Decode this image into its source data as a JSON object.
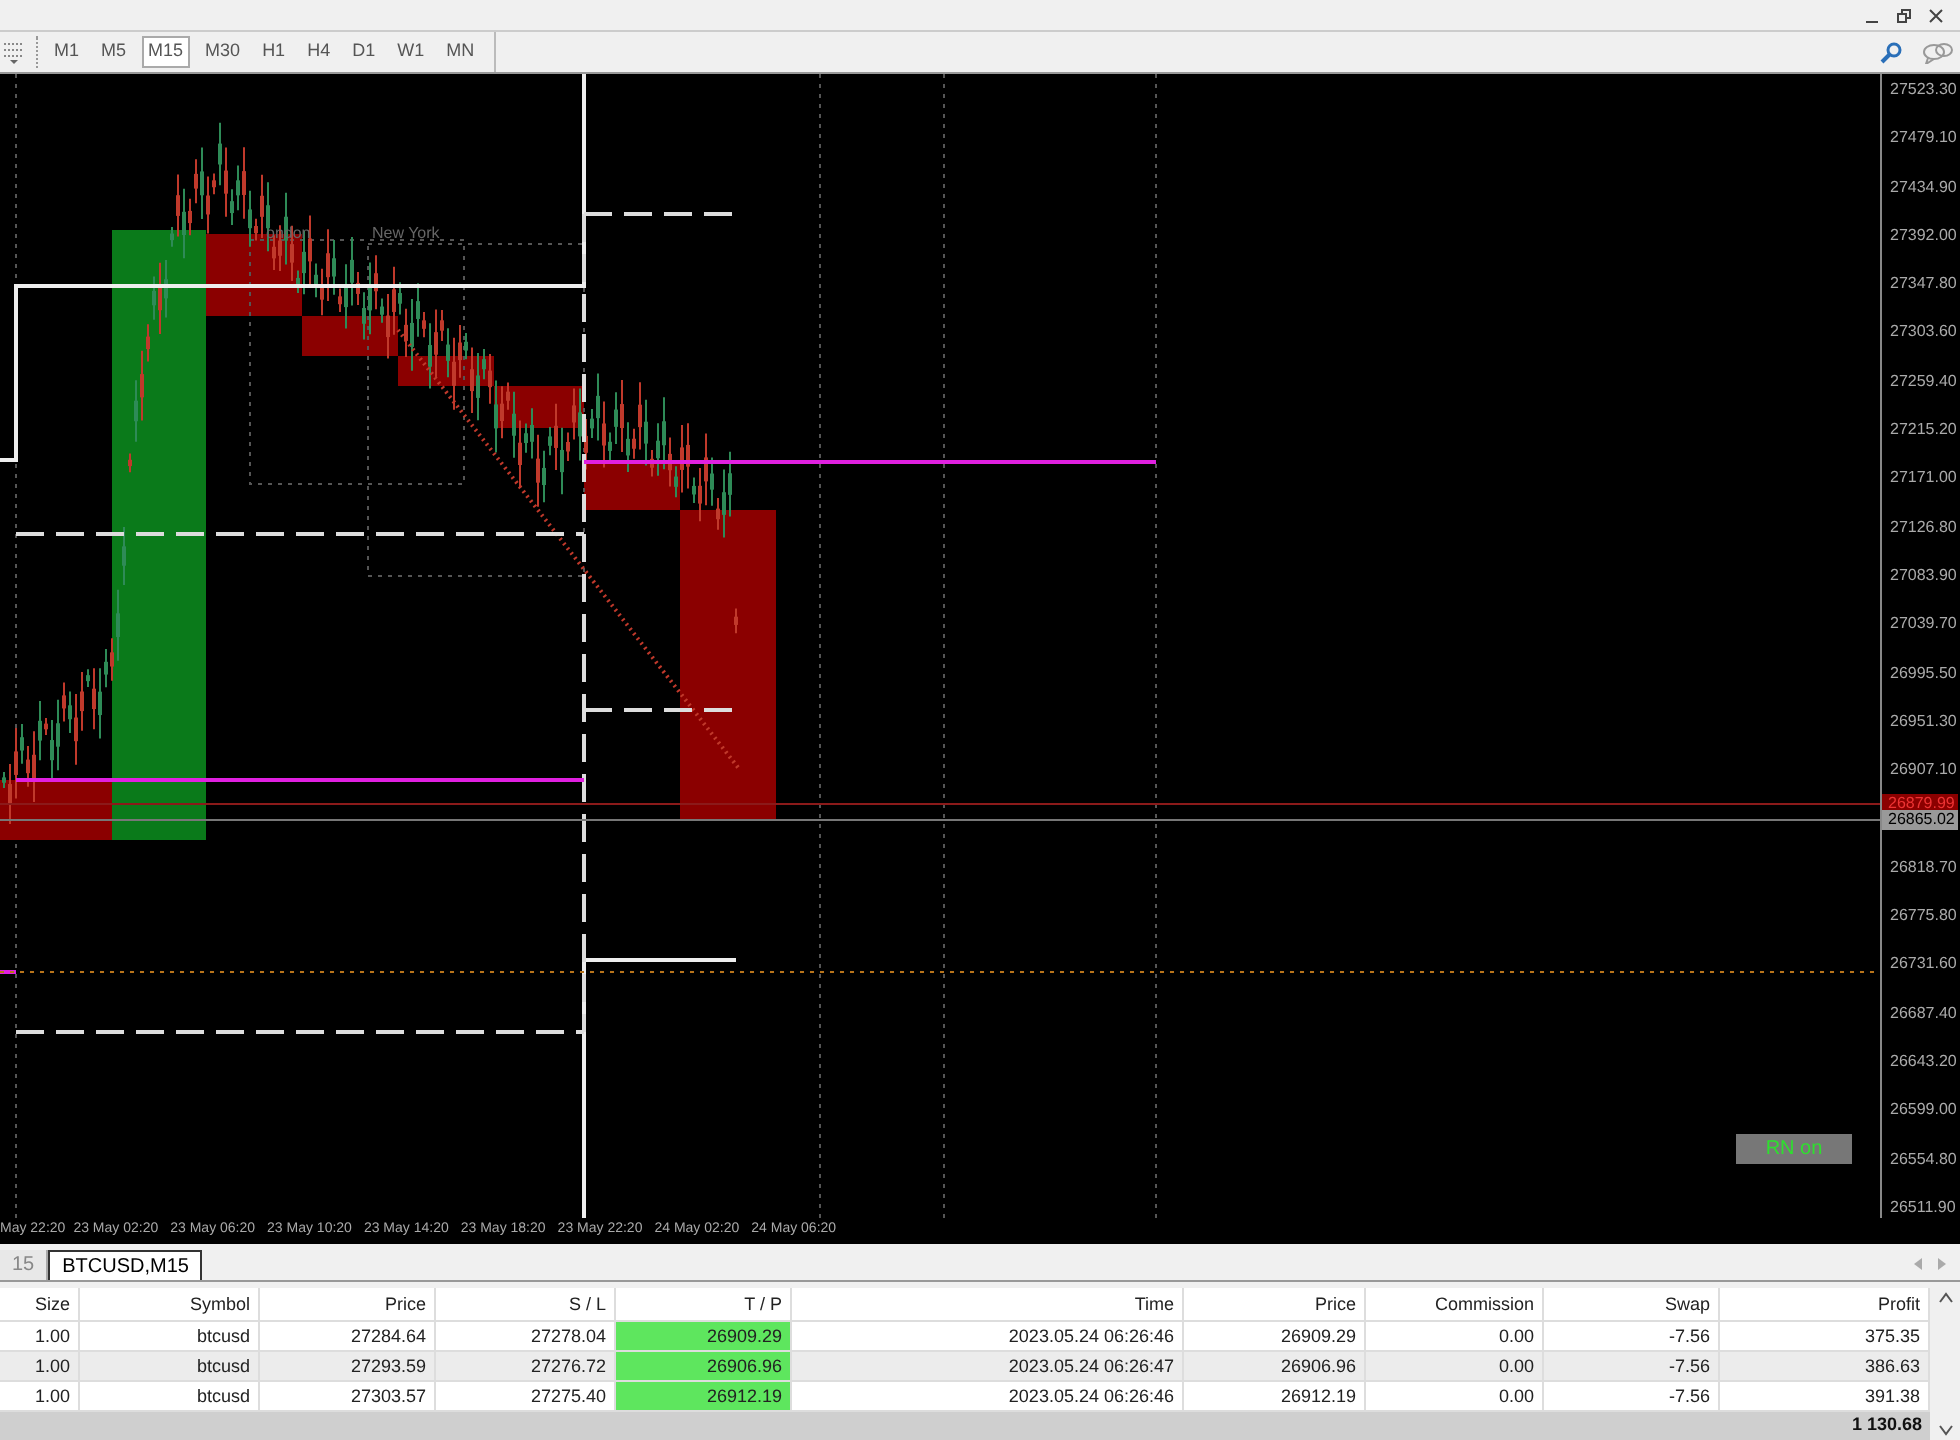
{
  "toolbar": {
    "timeframes": [
      {
        "label": "M1",
        "selected": false
      },
      {
        "label": "M5",
        "selected": false
      },
      {
        "label": "M15",
        "selected": true
      },
      {
        "label": "M30",
        "selected": false
      },
      {
        "label": "H1",
        "selected": false
      },
      {
        "label": "H4",
        "selected": false
      },
      {
        "label": "D1",
        "selected": false
      },
      {
        "label": "W1",
        "selected": false
      },
      {
        "label": "MN",
        "selected": false
      }
    ]
  },
  "chart": {
    "session_labels": [
      "ondon",
      "New York"
    ],
    "price_labels_upper": [
      "27523.30",
      "27479.10",
      "27434.90",
      "27392.00",
      "27347.80",
      "27303.60",
      "27259.40",
      "27215.20",
      "27171.00",
      "27126.80",
      "27083.90",
      "27039.70",
      "26995.50",
      "26951.30",
      "26907.10"
    ],
    "price_labels_lower": [
      "26818.70",
      "26775.80",
      "26731.60",
      "26687.40",
      "26643.20",
      "26599.00",
      "26554.80",
      "26511.90"
    ],
    "price_tags": [
      {
        "text": "26879.99",
        "kind": "bid"
      },
      {
        "text": "26865.02",
        "kind": "last"
      }
    ],
    "time_labels": [
      "May 22:20",
      "23 May 02:20",
      "23 May 06:20",
      "23 May 10:20",
      "23 May 14:20",
      "23 May 18:20",
      "23 May 22:20",
      "24 May 02:20",
      "24 May 06:20"
    ],
    "indicator_button": "RN on"
  },
  "tabs": [
    {
      "label": "15",
      "selected": false
    },
    {
      "label": "BTCUSD,M15",
      "selected": true
    }
  ],
  "table": {
    "columns": [
      "Size",
      "Symbol",
      "Price",
      "S / L",
      "T / P",
      "Time",
      "Price",
      "Commission",
      "Swap",
      "Profit"
    ],
    "rows": [
      [
        "1.00",
        "btcusd",
        "27284.64",
        "27278.04",
        "26909.29",
        "2023.05.24 06:26:46",
        "26909.29",
        "0.00",
        "-7.56",
        "375.35"
      ],
      [
        "1.00",
        "btcusd",
        "27293.59",
        "27276.72",
        "26906.96",
        "2023.05.24 06:26:47",
        "26906.96",
        "0.00",
        "-7.56",
        "386.63"
      ],
      [
        "1.00",
        "btcusd",
        "27303.57",
        "27275.40",
        "26912.19",
        "2023.05.24 06:26:46",
        "26912.19",
        "0.00",
        "-7.56",
        "391.38"
      ]
    ],
    "total": "1 130.68"
  }
}
